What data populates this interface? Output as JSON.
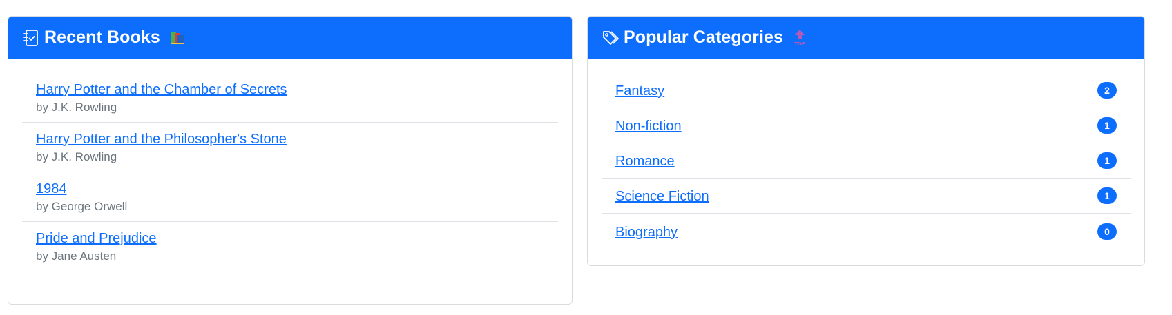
{
  "recent_books": {
    "title": "Recent Books",
    "header_icon": "journal-check-icon",
    "emoji_icon": "books-emoji-icon",
    "items": [
      {
        "title": "Harry Potter and the Chamber of Secrets",
        "author": "by J.K. Rowling"
      },
      {
        "title": "Harry Potter and the Philosopher's Stone",
        "author": "by J.K. Rowling"
      },
      {
        "title": "1984",
        "author": "by George Orwell"
      },
      {
        "title": "Pride and Prejudice",
        "author": "by Jane Austen"
      }
    ]
  },
  "popular_categories": {
    "title": "Popular Categories",
    "header_icon": "tags-icon",
    "emoji_icon": "top-arrow-emoji-icon",
    "items": [
      {
        "name": "Fantasy",
        "count": "2"
      },
      {
        "name": "Non-fiction",
        "count": "1"
      },
      {
        "name": "Romance",
        "count": "1"
      },
      {
        "name": "Science Fiction",
        "count": "1"
      },
      {
        "name": "Biography",
        "count": "0"
      }
    ]
  },
  "colors": {
    "primary": "#0d6efd",
    "muted_text": "#6c757d",
    "divider": "#dee2e6"
  }
}
